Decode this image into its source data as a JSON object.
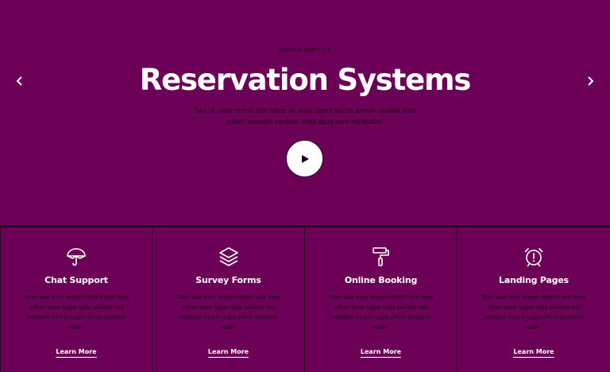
{
  "hero": {
    "subtitle": "SAMPLE SUBTITLE",
    "title": "Reservation Systems",
    "description_line1": "Sed ut unde omnis iste natus sit volur tatem accus antium laudan tium",
    "description_line2": "totam aperiam veritatis vitae dicta sunt explicabo.",
    "prev_icon": "chevron-left-icon",
    "next_icon": "chevron-right-icon",
    "play_icon": "play-icon"
  },
  "features": [
    {
      "icon": "umbrella-icon",
      "title": "Chat Support",
      "text": "Duis aute irure repreh enderit velit esse cillum dolor fugiat nulla pariatur sint proident sunt in culpa officia deserunt mollit .",
      "link": "Learn More"
    },
    {
      "icon": "layers-icon",
      "title": "Survey Forms",
      "text": "Duis aute irure repreh enderit velit esse cillum dolor fugiat nulla pariatur sint proident sunt in culpa officia deserunt mollit .",
      "link": "Learn More"
    },
    {
      "icon": "paint-roller-icon",
      "title": "Online Booking",
      "text": "Duis aute irure repreh enderit velit esse cillum dolor fugiat nulla pariatur sint proident sunt in culpa officia deserunt mollit .",
      "link": "Learn More"
    },
    {
      "icon": "alarm-clock-icon",
      "title": "Landing Pages",
      "text": "Duis aute irure repreh enderit velit esse cillum dolor fugiat nulla pariatur sint proident sunt in culpa officia deserunt mollit .",
      "link": "Learn More"
    }
  ],
  "colors": {
    "background": "#6b0056",
    "text_dark": "#1a0a15",
    "text_light": "#ffffff"
  }
}
